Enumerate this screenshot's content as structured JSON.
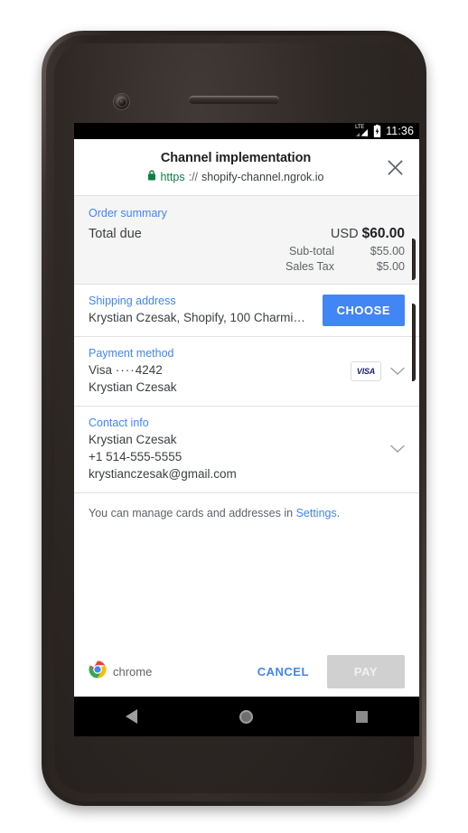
{
  "status_bar": {
    "network_label": "LTE",
    "battery_icon": "battery-charging-icon",
    "time": "11:36"
  },
  "sheet": {
    "title": "Channel implementation",
    "origin": {
      "lock_icon": "lock-icon",
      "scheme": "https",
      "separator": "://",
      "host": "shopify-channel.ngrok.io"
    },
    "close_icon": "close-icon"
  },
  "order_summary": {
    "label": "Order summary",
    "total_label": "Total due",
    "currency": "USD",
    "total_amount": "$60.00",
    "rows": [
      {
        "label": "Sub-total",
        "value": "$55.00"
      },
      {
        "label": "Sales Tax",
        "value": "$5.00"
      }
    ]
  },
  "shipping_address": {
    "label": "Shipping address",
    "value": "Krystian Czesak, Shopify, 100 Charming…",
    "choose_label": "CHOOSE"
  },
  "payment_method": {
    "label": "Payment method",
    "card_brand": "Visa",
    "card_dots": "····",
    "card_last4": "4242",
    "card_holder": "Krystian Czesak",
    "brand_badge": "VISA",
    "expand_icon": "chevron-down-icon"
  },
  "contact_info": {
    "label": "Contact info",
    "name": "Krystian Czesak",
    "phone": "+1 514-555-5555",
    "email": "krystianczesak@gmail.com",
    "expand_icon": "chevron-down-icon"
  },
  "manage_note": {
    "text_before": "You can manage cards and addresses in ",
    "link": "Settings",
    "text_after": "."
  },
  "bottom_bar": {
    "brand_icon": "chrome-logo-icon",
    "brand_label": "chrome",
    "cancel_label": "CANCEL",
    "pay_label": "PAY"
  },
  "nav_bar": {
    "back_icon": "back-triangle-icon",
    "home_icon": "home-circle-icon",
    "recents_icon": "recents-square-icon"
  },
  "colors": {
    "accent_blue": "#4285f4",
    "secure_green": "#0b8043",
    "summary_bg": "#f5f5f5",
    "pay_disabled": "#d0d0d0"
  }
}
